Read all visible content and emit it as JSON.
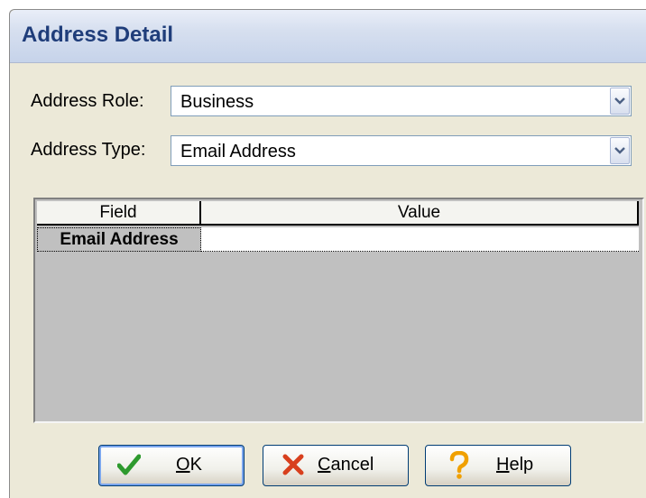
{
  "dialog": {
    "title": "Address Detail"
  },
  "form": {
    "role_label": "Address Role:",
    "role_value": "Business",
    "type_label": "Address Type:",
    "type_value": "Email Address"
  },
  "grid": {
    "headers": [
      "Field",
      "Value"
    ],
    "rows": [
      {
        "field": "Email Address",
        "value": ""
      }
    ]
  },
  "buttons": {
    "ok": {
      "label": "OK",
      "mnemonic": "O",
      "rest": "K",
      "icon": "check-icon"
    },
    "cancel": {
      "label": "Cancel",
      "mnemonic": "C",
      "rest": "ancel",
      "icon": "x-icon"
    },
    "help": {
      "label": "Help",
      "mnemonic": "H",
      "rest": "elp",
      "icon": "question-icon"
    }
  },
  "colors": {
    "title": "#1f3d7a",
    "check": "#2e9a2e",
    "cancel_x": "#d8401e",
    "help_q": "#f0a000",
    "grid_bg": "#c0c0c0"
  }
}
